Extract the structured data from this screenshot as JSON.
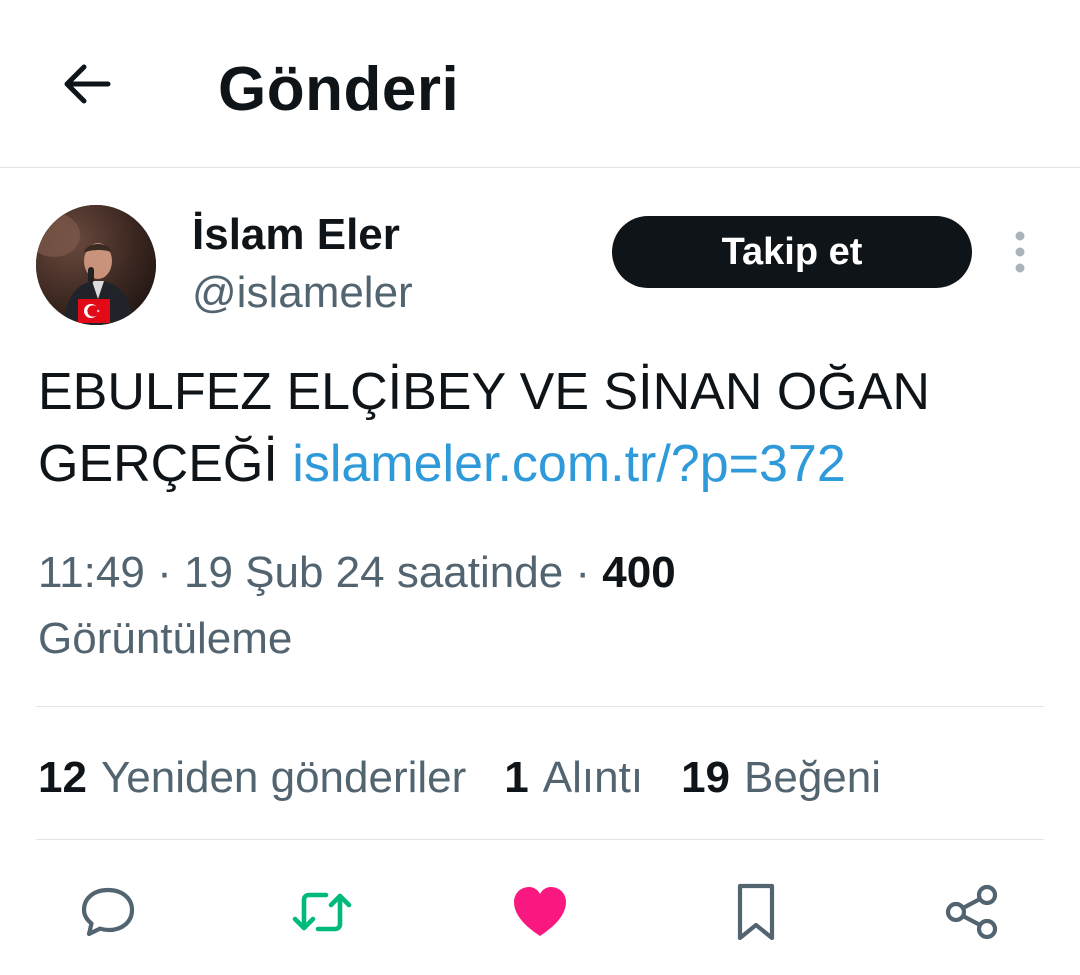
{
  "header": {
    "title": "Gönderi",
    "back_icon": "arrow-left-icon"
  },
  "author": {
    "name": "İslam Eler",
    "handle": "@islameler",
    "follow_label": "Takip et",
    "avatar_icon": "profile-photo"
  },
  "tweet": {
    "text": "EBULFEZ ELÇİBEY VE SİNAN OĞAN GERÇEĞİ",
    "link": "islameler.com.tr/?p=372"
  },
  "meta": {
    "time": "11:49",
    "date": "19 Şub 24 saatinde",
    "views_count": "400",
    "views_label": "Görüntüleme"
  },
  "stats": {
    "reposts_count": "12",
    "reposts_label": "Yeniden gönderiler",
    "quotes_count": "1",
    "quotes_label": "Alıntı",
    "likes_count": "19",
    "likes_label": "Beğeni"
  },
  "colors": {
    "link": "#2f9ad9",
    "retweet_active": "#00ba7c",
    "like_active": "#f91880",
    "secondary_text": "#536471"
  },
  "actions": {
    "icons": [
      "reply-icon",
      "retweet-icon",
      "like-icon",
      "bookmark-icon",
      "share-icon"
    ]
  }
}
